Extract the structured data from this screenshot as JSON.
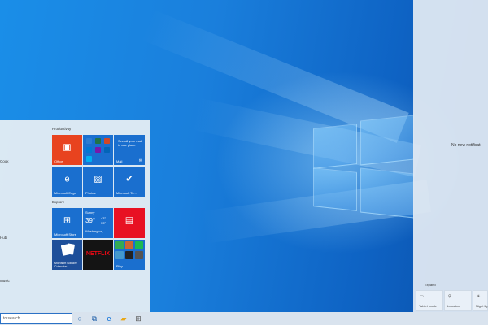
{
  "start_menu": {
    "app_list": [
      "",
      "",
      "Cook",
      "",
      "Hub",
      "",
      "Music"
    ],
    "groups": {
      "productivity": "Productivity",
      "explore": "Explore"
    },
    "tiles": {
      "office": "Office",
      "mail_promo": "See all your mail in one place",
      "mail": "Mail",
      "edge": "Microsoft Edge",
      "photos": "Photos",
      "todo": "Microsoft To...",
      "store": "Microsoft Store",
      "weather_cond": "Sunny",
      "weather_temp": "39°",
      "weather_hi": "43°",
      "weather_lo": "33°",
      "weather_city": "Washington,...",
      "solitaire": "Microsoft Solitaire Collection",
      "netflix": "NETFLIX",
      "play": "Play"
    }
  },
  "action_center": {
    "no_notifications": "No new notificati",
    "expand": "Expand",
    "quick_actions": [
      "Tablet mode",
      "Location",
      "Night lig"
    ]
  },
  "taskbar": {
    "search_placeholder": "to search"
  },
  "colors": {
    "office_red": "#e8431f",
    "tile_blue": "#1a6fcf",
    "news_red": "#e81123",
    "netflix_black": "#141414",
    "taskbar": "#d9e3ee"
  },
  "icons": {
    "office": "office-icon",
    "mail": "mail-icon",
    "edge": "edge-icon",
    "photos": "photos-icon",
    "todo": "todo-icon",
    "store": "store-icon",
    "news": "news-icon",
    "cortana": "cortana-icon",
    "task_view": "task-view-icon",
    "explorer": "file-explorer-icon"
  }
}
